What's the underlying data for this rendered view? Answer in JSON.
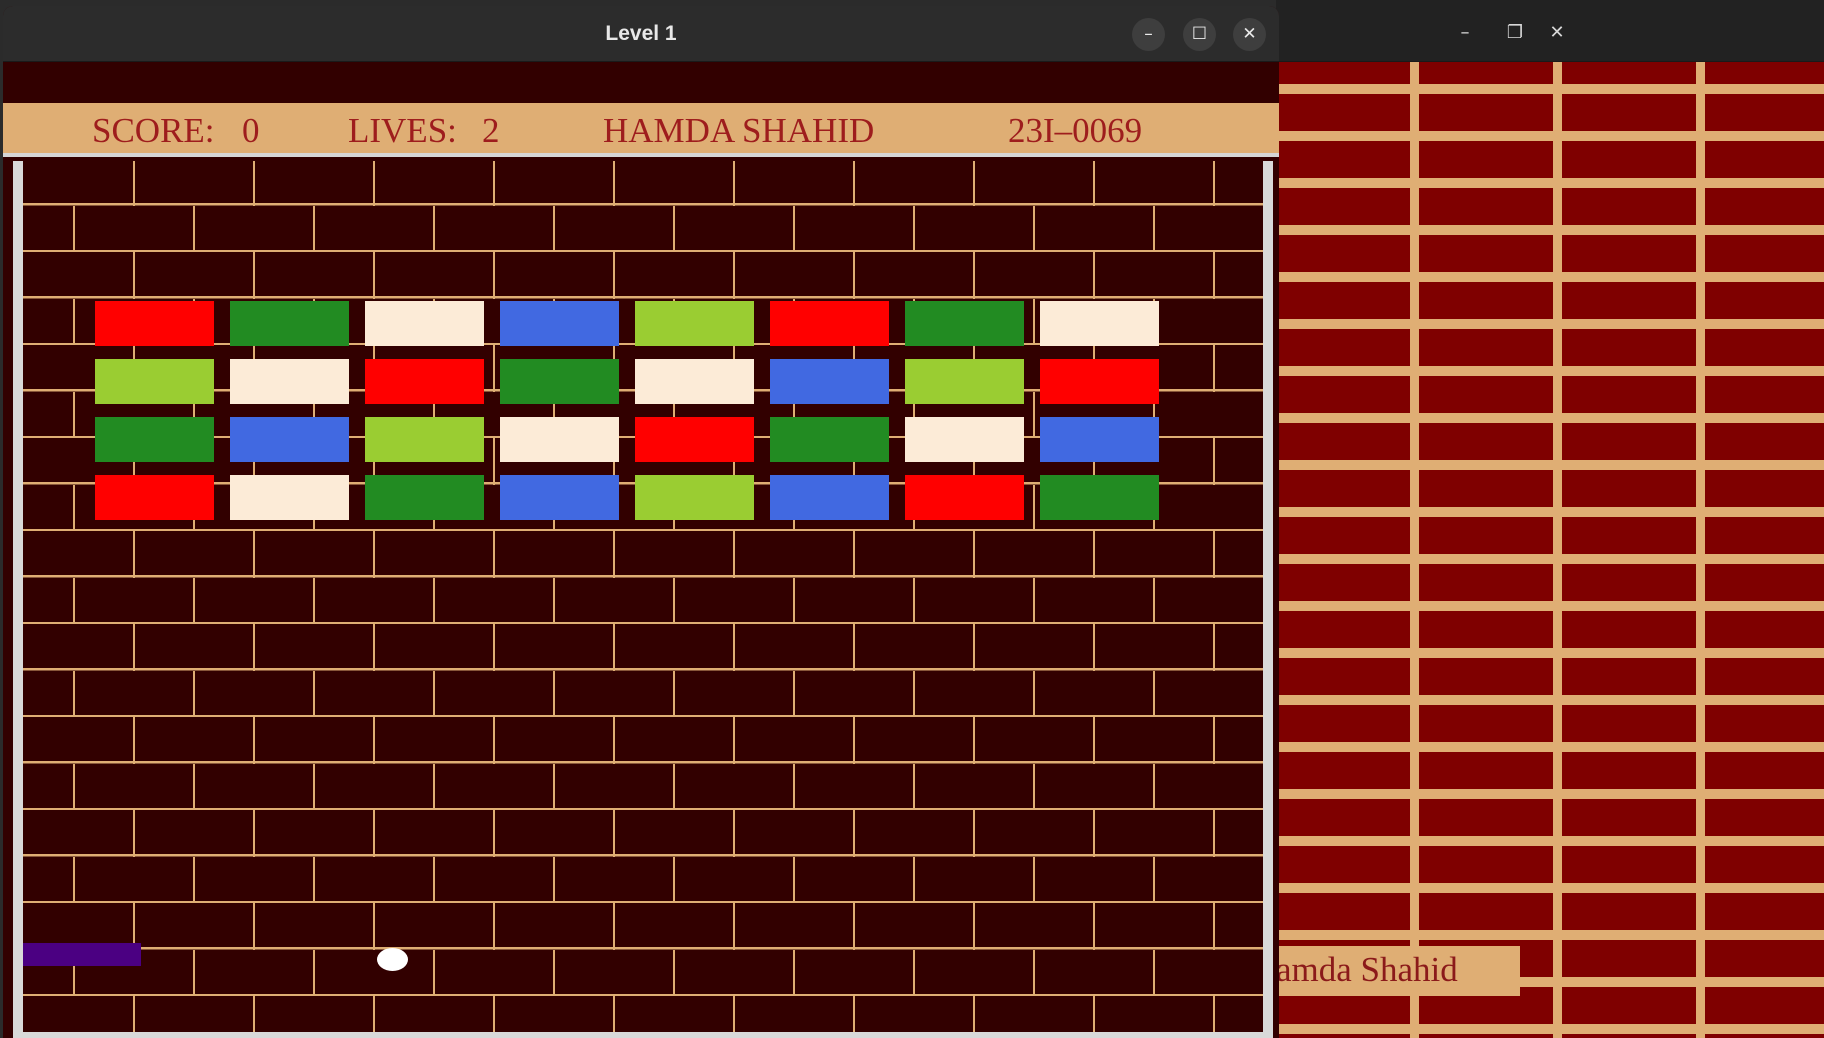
{
  "background_window": {
    "controls": {
      "minimize": "–",
      "restore": "❐",
      "close": "✕"
    },
    "name_text": "amda Shahid",
    "brick_color": "#7f0000",
    "mortar_color": "#dfae74"
  },
  "window": {
    "title": "Level 1",
    "controls": {
      "minimize": "–",
      "maximize": "☐",
      "close": "✕"
    }
  },
  "hud": {
    "score_label": "SCORE:",
    "score_value": "0",
    "lives_label": "LIVES:",
    "lives_value": "2",
    "player_name": "HAMDA SHAHID",
    "player_id": "23I–0069",
    "background_color": "#dfae74",
    "text_color": "#9e1d1d"
  },
  "bricks": {
    "palette": {
      "red": "#ff0000",
      "green": "#228b22",
      "cream": "#fcebd7",
      "blue": "#4169e1",
      "lime": "#9acd32"
    },
    "rows": [
      [
        "red",
        "green",
        "cream",
        "blue",
        "lime",
        "red",
        "green",
        "cream"
      ],
      [
        "lime",
        "cream",
        "red",
        "green",
        "cream",
        "blue",
        "lime",
        "red"
      ],
      [
        "green",
        "blue",
        "lime",
        "cream",
        "red",
        "green",
        "cream",
        "blue"
      ],
      [
        "red",
        "cream",
        "green",
        "blue",
        "lime",
        "blue",
        "red",
        "green"
      ]
    ]
  },
  "paddle": {
    "color": "#4b0082"
  },
  "ball": {
    "color": "#ffffff"
  }
}
